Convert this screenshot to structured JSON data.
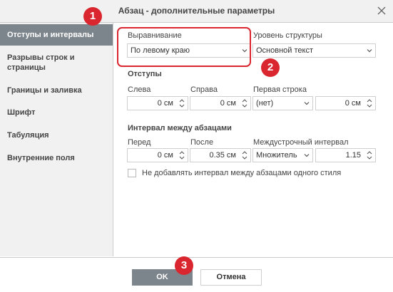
{
  "dialog": {
    "title": "Абзац - дополнительные параметры"
  },
  "sidebar": {
    "items": [
      {
        "label": "Отступы и интервалы",
        "active": true
      },
      {
        "label": "Разрывы строк и страницы",
        "active": false
      },
      {
        "label": "Границы и заливка",
        "active": false
      },
      {
        "label": "Шрифт",
        "active": false
      },
      {
        "label": "Табуляция",
        "active": false
      },
      {
        "label": "Внутренние поля",
        "active": false
      }
    ]
  },
  "alignment": {
    "label": "Выравнивание",
    "value": "По левому краю"
  },
  "outline_level": {
    "label": "Уровень структуры",
    "value": "Основной текст"
  },
  "indents": {
    "section_label": "Отступы",
    "left_label": "Слева",
    "left_value": "0 см",
    "right_label": "Справа",
    "right_value": "0 см",
    "first_line_label": "Первая строка",
    "first_line_type": "(нет)",
    "first_line_value": "0 см"
  },
  "spacing": {
    "section_label": "Интервал между абзацами",
    "before_label": "Перед",
    "before_value": "0 см",
    "after_label": "После",
    "after_value": "0.35 см",
    "line_spacing_label": "Междустрочный интервал",
    "line_spacing_type": "Множитель",
    "line_spacing_value": "1.15"
  },
  "dont_add_interval": {
    "label": "Не добавлять интервал между абзацами одного стиля",
    "checked": false
  },
  "annotations": {
    "badge1": "1",
    "badge2": "2",
    "badge3": "3",
    "color": "#d9262f"
  },
  "buttons": {
    "ok_label": "OK",
    "cancel_label": "Отмена"
  },
  "colors": {
    "active_sidebar": "#7d858c",
    "ok_button": "#7d858c"
  }
}
